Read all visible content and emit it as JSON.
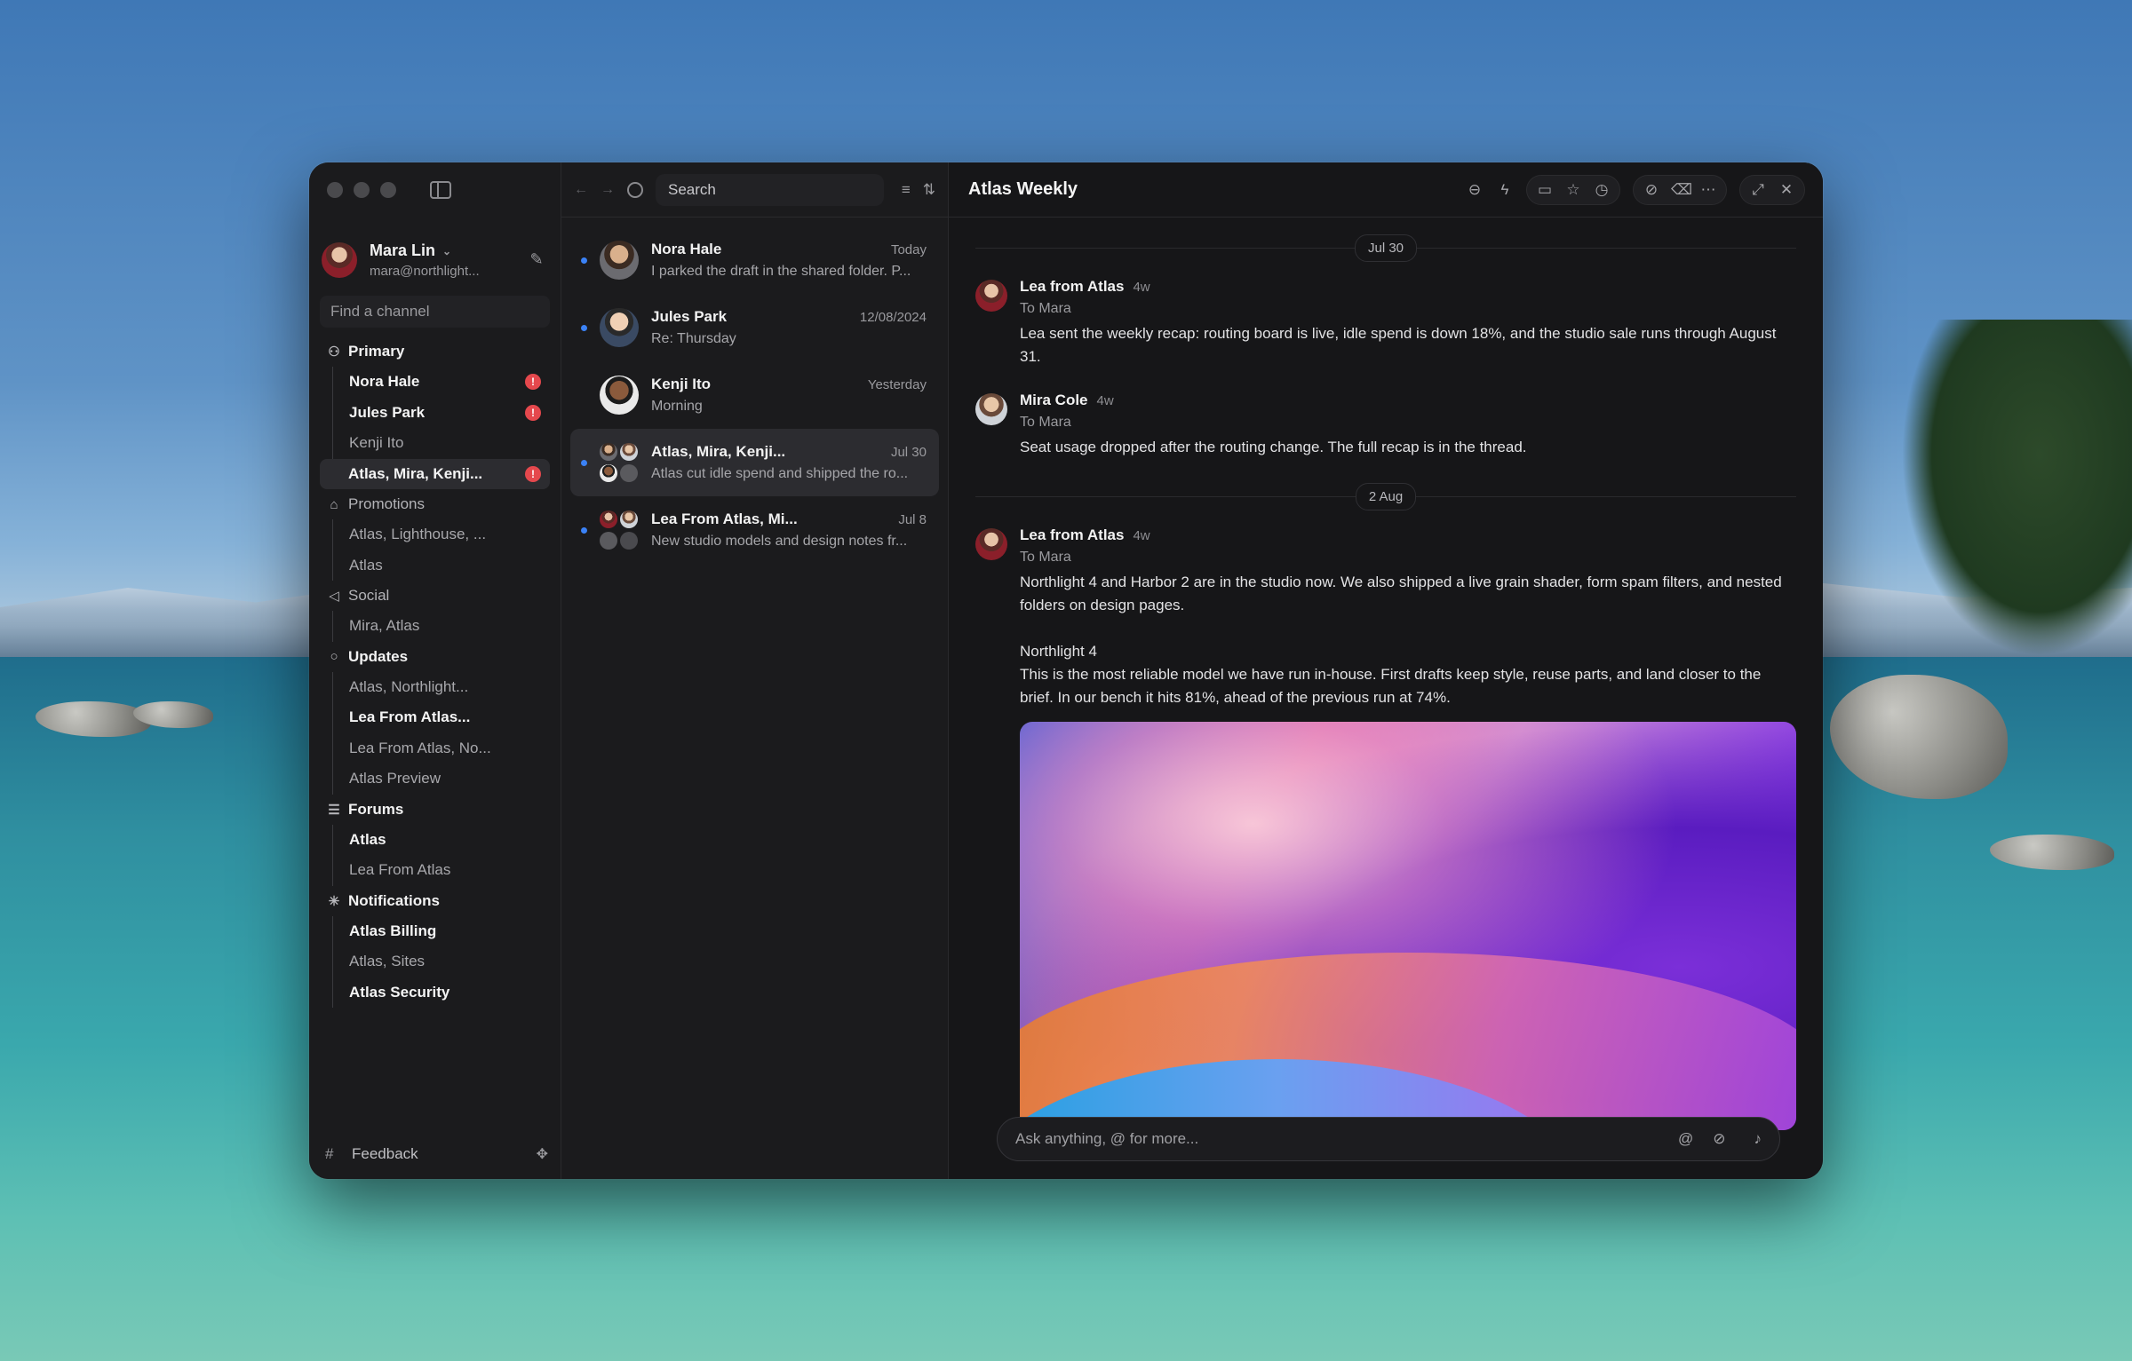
{
  "account": {
    "name": "Mara Lin",
    "email": "mara@northlight..."
  },
  "sidebar": {
    "find_placeholder": "Find a channel",
    "groups": [
      {
        "label": "Primary",
        "icon": "person-icon",
        "items": [
          {
            "label": "Nora Hale",
            "badge": "!"
          },
          {
            "label": "Jules Park",
            "badge": "!"
          },
          {
            "label": "Kenji Ito"
          },
          {
            "label": "Atlas, Mira, Kenji...",
            "badge": "!"
          }
        ]
      },
      {
        "label": "Promotions",
        "icon": "tag-icon",
        "items": [
          {
            "label": "Atlas, Lighthouse, ..."
          },
          {
            "label": "Atlas"
          }
        ]
      },
      {
        "label": "Social",
        "icon": "megaphone-icon",
        "items": [
          {
            "label": "Mira, Atlas"
          }
        ]
      },
      {
        "label": "Updates",
        "icon": "chat-bubble-icon",
        "items": [
          {
            "label": "Atlas, Northlight..."
          },
          {
            "label": "Lea From Atlas..."
          },
          {
            "label": "Lea From Atlas, No..."
          },
          {
            "label": "Atlas Preview"
          }
        ]
      },
      {
        "label": "Forums",
        "icon": "list-icon",
        "items": [
          {
            "label": "Atlas"
          },
          {
            "label": "Lea From Atlas"
          }
        ]
      },
      {
        "label": "Notifications",
        "icon": "asterisk-icon",
        "items": [
          {
            "label": "Atlas Billing"
          },
          {
            "label": "Atlas, Sites"
          },
          {
            "label": "Atlas Security"
          }
        ]
      }
    ],
    "feedback": "Feedback"
  },
  "list": {
    "search_placeholder": "Search",
    "threads": [
      {
        "name": "Nora Hale",
        "date": "Today",
        "snippet": "I parked the draft in the shared folder. P..."
      },
      {
        "name": "Jules Park",
        "date": "12/08/2024",
        "snippet": "Re: Thursday"
      },
      {
        "name": "Kenji Ito",
        "date": "Yesterday",
        "snippet": "Morning"
      },
      {
        "name": "Atlas, Mira, Kenji...",
        "date": "Jul 30",
        "snippet": "Atlas cut idle spend and shipped the ro..."
      },
      {
        "name": "Lea From Atlas, Mi...",
        "date": "Jul 8",
        "snippet": "New studio models and design notes fr..."
      }
    ]
  },
  "main": {
    "title": "Atlas Weekly",
    "dividers": [
      "Jul 30",
      "2 Aug"
    ],
    "messages": [
      {
        "name": "Lea from Atlas",
        "ago": "4w",
        "to": "To Mara",
        "text": "Lea sent the weekly recap: routing board is live, idle spend is down 18%, and the studio sale runs through August 31."
      },
      {
        "name": "Mira Cole",
        "ago": "4w",
        "to": "To Mara",
        "text": "Seat usage dropped after the routing change. The full recap is in the thread."
      },
      {
        "name": "Lea from Atlas",
        "ago": "4w",
        "to": "To Mara",
        "text": "Northlight 4 and Harbor 2 are in the studio now. We also shipped a live grain shader, form spam filters, and nested folders on design pages.",
        "subhead": "Northlight 4",
        "text2": "This is the most reliable model we have run in-house. First drafts keep style, reuse parts, and land closer to the brief. In our bench it hits 81%, ahead of the previous run at 74%."
      }
    ],
    "composer_placeholder": "Ask anything, @ for more..."
  }
}
